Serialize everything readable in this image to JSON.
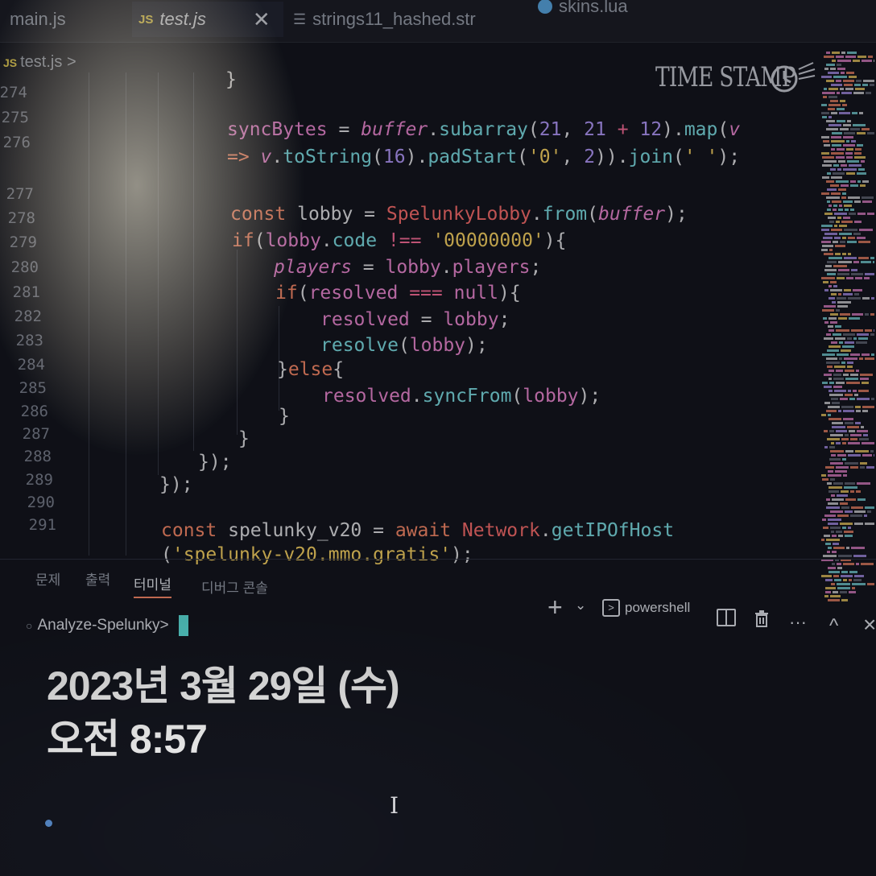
{
  "tabs": [
    {
      "label": "main.js",
      "icon": "js-file-icon"
    },
    {
      "label": "test.js",
      "icon": "js-file-icon",
      "active": true,
      "icon_text": "JS"
    },
    {
      "label": "strings11_hashed.str",
      "icon": "text-file-icon"
    },
    {
      "label": "skins.lua",
      "icon": "lua-file-icon"
    }
  ],
  "breadcrumb": {
    "icon_text": "JS",
    "file": "test.js",
    "sep": ">"
  },
  "line_numbers": [
    "274",
    "275",
    "276",
    "277",
    "278",
    "279",
    "280",
    "281",
    "282",
    "283",
    "284",
    "285",
    "286",
    "287",
    "288",
    "289",
    "290",
    "291"
  ],
  "code": {
    "l274": "}",
    "l276a_1": "syncBytes",
    "l276a_2": " = ",
    "l276a_3": "buffer",
    "l276a_4": ".",
    "l276a_5": "subarray",
    "l276a_6": "(",
    "l276a_7": "21",
    "l276a_8": ", ",
    "l276a_9": "21",
    "l276a_10": " + ",
    "l276a_11": "12",
    "l276a_12": ").",
    "l276a_13": "map",
    "l276a_14": "(",
    "l276a_15": "v",
    "l276b_1": "=> ",
    "l276b_2": "v",
    "l276b_3": ".",
    "l276b_4": "toString",
    "l276b_5": "(",
    "l276b_6": "16",
    "l276b_7": ").",
    "l276b_8": "padStart",
    "l276b_9": "(",
    "l276b_10": "'0'",
    "l276b_11": ", ",
    "l276b_12": "2",
    "l276b_13": ")).",
    "l276b_14": "join",
    "l276b_15": "(",
    "l276b_16": "' '",
    "l276b_17": ");",
    "l278_1": "const",
    "l278_2": " lobby = ",
    "l278_3": "SpelunkyLobby",
    "l278_4": ".",
    "l278_5": "from",
    "l278_6": "(",
    "l278_7": "buffer",
    "l278_8": ");",
    "l279_1": "if",
    "l279_2": "(",
    "l279_3": "lobby",
    "l279_4": ".",
    "l279_5": "code",
    "l279_6": " !== ",
    "l279_7": "'00000000'",
    "l279_8": "){",
    "l280_1": "players",
    "l280_2": " = ",
    "l280_3": "lobby",
    "l280_4": ".",
    "l280_5": "players",
    "l280_6": ";",
    "l281_1": "if",
    "l281_2": "(",
    "l281_3": "resolved",
    "l281_4": " === ",
    "l281_5": "null",
    "l281_6": "){",
    "l282_1": "resolved",
    "l282_2": " = ",
    "l282_3": "lobby",
    "l282_4": ";",
    "l283_1": "resolve",
    "l283_2": "(",
    "l283_3": "lobby",
    "l283_4": ");",
    "l284_1": "}",
    "l284_2": "else",
    "l284_3": "{",
    "l285_1": "resolved",
    "l285_2": ".",
    "l285_3": "syncFrom",
    "l285_4": "(",
    "l285_5": "lobby",
    "l285_6": ");",
    "l286": "}",
    "l287": "}",
    "l288": "});",
    "l289": "});",
    "l291a_1": "const",
    "l291a_2": " spelunky_v20 = ",
    "l291a_3": "await",
    "l291a_4": " ",
    "l291a_5": "Network",
    "l291a_6": ".",
    "l291a_7": "getIPOfHost",
    "l291b_1": "(",
    "l291b_2": "'spelunky-v20.mmo.gratis'",
    "l291b_3": ");"
  },
  "stamp_label": "TIME STAMP",
  "panel": {
    "tabs": [
      "문제",
      "출력",
      "터미널",
      "디버그 콘솔"
    ],
    "active_tab": "터미널",
    "plus": "+",
    "chevron": "⌄",
    "shell_label": "powershell",
    "more": "···",
    "caret_up": "^",
    "close": "×"
  },
  "terminal": {
    "prompt": "Analyze-Spelunky>"
  },
  "overlay": {
    "date": "2023년 3월 29일 (수)",
    "time": "오전 8:57"
  },
  "colors": {
    "keyword": "#ff8c6b",
    "variable": "#f08ad6",
    "function": "#7fe2e8",
    "number": "#b59bff",
    "string": "#ffd866",
    "cursor": "#5fe6e0"
  }
}
